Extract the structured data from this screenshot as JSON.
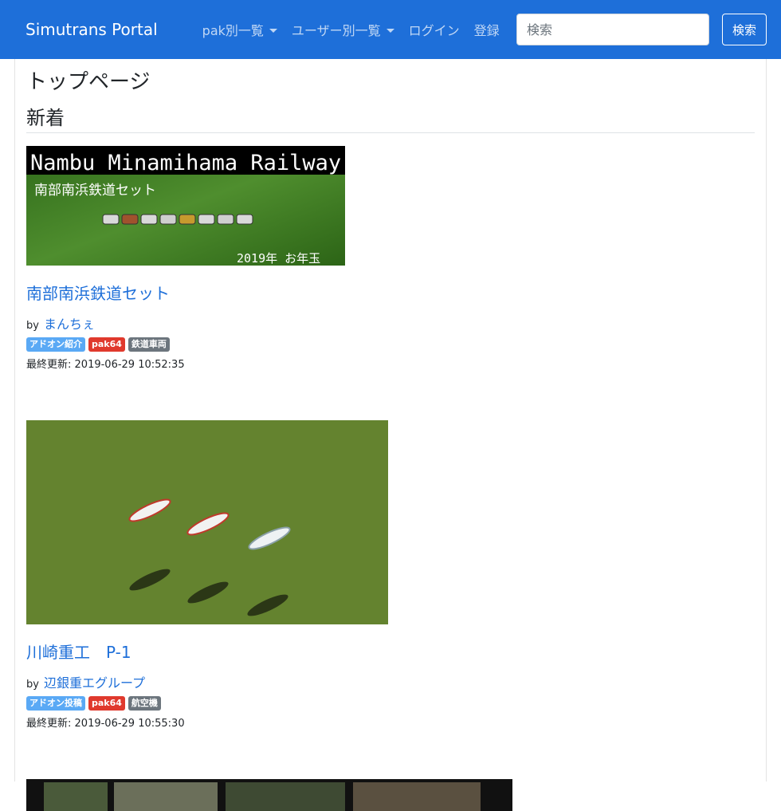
{
  "navbar": {
    "brand": "Simutrans Portal",
    "items": [
      {
        "label": "pak別一覧"
      },
      {
        "label": "ユーザー別一覧"
      },
      {
        "label": "ログイン"
      },
      {
        "label": "登録"
      }
    ],
    "search_placeholder": "検索",
    "search_button": "検索"
  },
  "page": {
    "title": "トップページ",
    "section": "新着"
  },
  "articles": [
    {
      "title": "南部南浜鉄道セット",
      "by_label": "by",
      "author": "まんちぇ",
      "tags": [
        "アドオン紹介",
        "pak64",
        "鉄道車両"
      ],
      "updated_label": "最終更新:",
      "updated": "2019-06-29 10:52:35",
      "banner_title": "Nambu Minamihama Railway",
      "banner_subtitle": "南部南浜鉄道セット",
      "banner_note": "2019年 お年玉"
    },
    {
      "title": "川崎重工　P-1",
      "by_label": "by",
      "author": "辺銀重エグループ",
      "tags": [
        "アドオン投稿",
        "pak64",
        "航空機"
      ],
      "updated_label": "最終更新:",
      "updated": "2019-06-29 10:55:30"
    }
  ],
  "colors": {
    "navbar": "#1e6fd9",
    "link": "#1e6fd9",
    "badge_info": "#5aa9f5",
    "badge_pak": "#e0392d",
    "badge_category": "#6c757d"
  }
}
